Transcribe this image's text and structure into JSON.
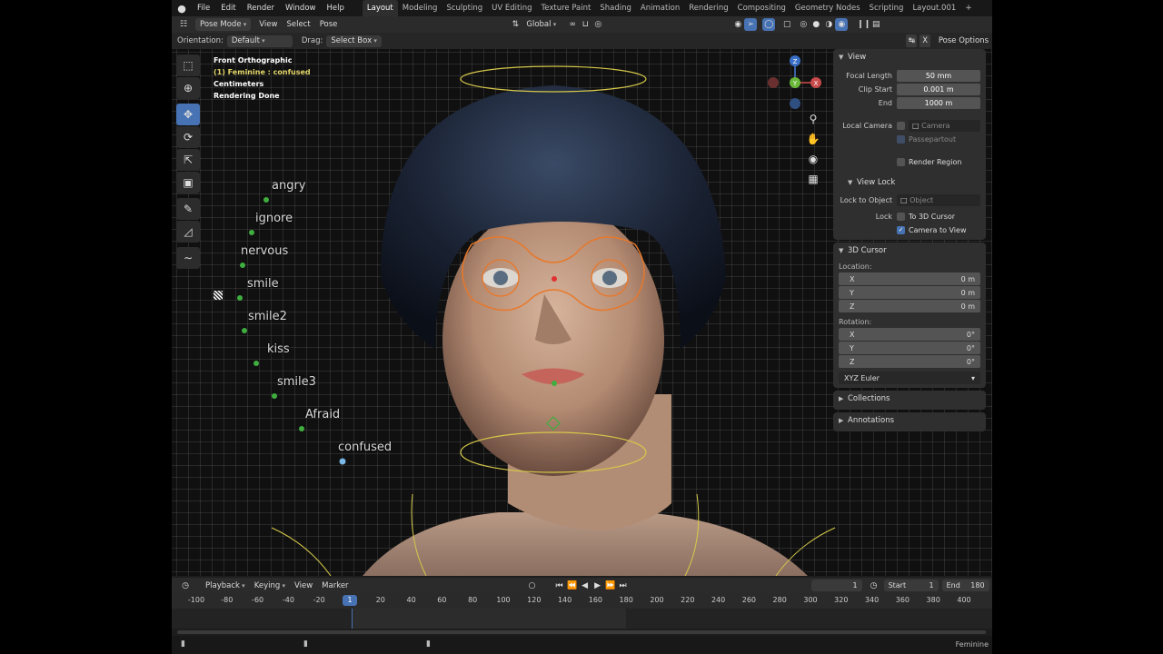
{
  "menu": {
    "items": [
      "File",
      "Edit",
      "Render",
      "Window",
      "Help"
    ]
  },
  "workspaces": {
    "tabs": [
      "Layout",
      "Modeling",
      "Sculpting",
      "UV Editing",
      "Texture Paint",
      "Shading",
      "Animation",
      "Rendering",
      "Compositing",
      "Geometry Nodes",
      "Scripting",
      "Layout.001"
    ],
    "active": "Layout",
    "plus": "+"
  },
  "header": {
    "mode": "Pose Mode",
    "view": "View",
    "select": "Select",
    "pose": "Pose",
    "transform_orientation": "Global"
  },
  "tool_settings": {
    "orientation_label": "Orientation:",
    "orientation_value": "Default",
    "drag_label": "Drag:",
    "drag_value": "Select Box",
    "pose_options": "Pose Options"
  },
  "viewport": {
    "overlay": {
      "view_name": "Front Orthographic",
      "object_info": "(1) Feminine : confused",
      "units": "Centimeters",
      "status": "Rendering Done"
    },
    "expressions": [
      "angry",
      "ignore",
      "nervous",
      "smile",
      "smile2",
      "kiss",
      "smile3",
      "Afraid",
      "confused"
    ],
    "gizmo": {
      "z": "Z",
      "y": "Y",
      "x": "X"
    }
  },
  "npanel": {
    "view": {
      "title": "View",
      "focal_length_label": "Focal Length",
      "focal_length": "50 mm",
      "clip_start_label": "Clip Start",
      "clip_start": "0.001 m",
      "end_label": "End",
      "end": "1000 m",
      "local_camera_label": "Local Camera",
      "camera_value": "Camera",
      "passepartout": "Passepartout",
      "render_region": "Render Region",
      "view_lock_title": "View Lock",
      "lock_to_object_label": "Lock to Object",
      "lock_object_placeholder": "Object",
      "lock_label": "Lock",
      "to_3d_cursor": "To 3D Cursor",
      "camera_to_view": "Camera to View"
    },
    "cursor": {
      "title": "3D Cursor",
      "location_label": "Location:",
      "loc": [
        {
          "axis": "X",
          "value": "0 m"
        },
        {
          "axis": "Y",
          "value": "0 m"
        },
        {
          "axis": "Z",
          "value": "0 m"
        }
      ],
      "rotation_label": "Rotation:",
      "rot": [
        {
          "axis": "X",
          "value": "0°"
        },
        {
          "axis": "Y",
          "value": "0°"
        },
        {
          "axis": "Z",
          "value": "0°"
        }
      ],
      "rotation_mode": "XYZ Euler"
    },
    "collections": "Collections",
    "annotations": "Annotations"
  },
  "timeline": {
    "playback": "Playback",
    "keying": "Keying",
    "view": "View",
    "marker": "Marker",
    "current_frame": "1",
    "start_label": "Start",
    "start": "1",
    "end_label": "End",
    "end": "180",
    "ruler": [
      "-100",
      "-80",
      "-60",
      "-40",
      "-20",
      "20",
      "40",
      "60",
      "80",
      "100",
      "120",
      "140",
      "160",
      "180",
      "200",
      "220",
      "240",
      "260",
      "280",
      "300",
      "320",
      "340",
      "360",
      "380",
      "400",
      "4"
    ],
    "current_marker": "1"
  },
  "status": {
    "right": "Feminine"
  },
  "colors": {
    "accent": "#4772b3",
    "bone_outline": "#e8782a",
    "bone_lines": "#d6c84a",
    "widget_green": "#3fae3f",
    "overlay_yellow": "#e4d66a"
  }
}
